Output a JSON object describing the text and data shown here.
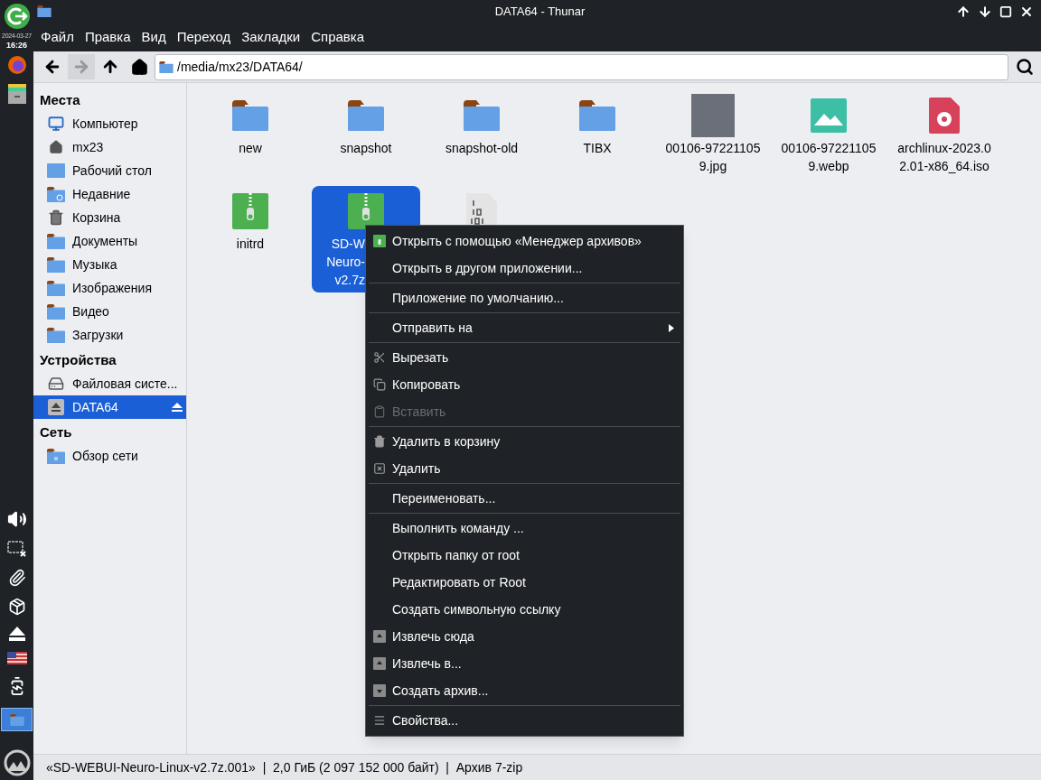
{
  "panel": {
    "date": "2024-03-27",
    "time": "16:26"
  },
  "window": {
    "title": "DATA64 - Thunar"
  },
  "menu_bar": [
    "Файл",
    "Правка",
    "Вид",
    "Переход",
    "Закладки",
    "Справка"
  ],
  "toolbar": {
    "back_disabled": false,
    "forward_disabled": true,
    "location": "/media/mx23/DATA64/"
  },
  "sidebar": [
    {
      "heading": "Места",
      "items": [
        {
          "label": "Компьютер",
          "kind": "computer",
          "selected": false
        },
        {
          "label": "mx23",
          "kind": "home",
          "selected": false
        },
        {
          "label": "Рабочий стол",
          "kind": "desktop",
          "selected": false
        },
        {
          "label": "Недавние",
          "kind": "recent",
          "selected": false
        },
        {
          "label": "Корзина",
          "kind": "trash",
          "selected": false
        },
        {
          "label": "Документы",
          "kind": "folder",
          "selected": false
        },
        {
          "label": "Музыка",
          "kind": "folder",
          "selected": false
        },
        {
          "label": "Изображения",
          "kind": "folder",
          "selected": false
        },
        {
          "label": "Видео",
          "kind": "folder",
          "selected": false
        },
        {
          "label": "Загрузки",
          "kind": "folder",
          "selected": false
        }
      ]
    },
    {
      "heading": "Устройства",
      "items": [
        {
          "label": "Файловая систе...",
          "kind": "drive",
          "selected": false
        },
        {
          "label": "DATA64",
          "kind": "removable",
          "selected": true
        }
      ]
    },
    {
      "heading": "Сеть",
      "items": [
        {
          "label": "Обзор сети",
          "kind": "network",
          "selected": false
        }
      ]
    }
  ],
  "files": [
    {
      "name": [
        "new"
      ],
      "kind": "folder",
      "selected": false
    },
    {
      "name": [
        "snapshot"
      ],
      "kind": "folder",
      "selected": false
    },
    {
      "name": [
        "snapshot-old"
      ],
      "kind": "folder",
      "selected": false
    },
    {
      "name": [
        "TIBX"
      ],
      "kind": "folder",
      "selected": false
    },
    {
      "name": [
        "00106-97221105",
        "9.jpg"
      ],
      "kind": "photo",
      "selected": false
    },
    {
      "name": [
        "00106-97221105",
        "9.webp"
      ],
      "kind": "image",
      "selected": false
    },
    {
      "name": [
        "archlinux-2023.0",
        "2.01-x86_64.iso"
      ],
      "kind": "disc",
      "selected": false
    },
    {
      "name": [
        "initrd"
      ],
      "kind": "archive",
      "selected": false
    },
    {
      "name": [
        "SD-W",
        "Neuro-",
        "v2.7z"
      ],
      "kind": "archive",
      "selected": true
    },
    {
      "kind": "binary",
      "selected": false
    }
  ],
  "context_menu": [
    {
      "kind": "archive",
      "label": "Открыть с помощью «Менеджер архивов»",
      "disabled": false
    },
    {
      "kind": "plain",
      "label": "Открыть в другом приложении...",
      "disabled": false
    },
    {
      "kind": "separator"
    },
    {
      "kind": "plain",
      "label": "Приложение по умолчанию...",
      "disabled": false
    },
    {
      "kind": "separator"
    },
    {
      "kind": "submenu",
      "label": "Отправить на",
      "disabled": false
    },
    {
      "kind": "separator"
    },
    {
      "kind": "cut",
      "label": "Вырезать",
      "disabled": false
    },
    {
      "kind": "copy",
      "label": "Копировать",
      "disabled": false
    },
    {
      "kind": "paste",
      "label": "Вставить",
      "disabled": true
    },
    {
      "kind": "separator"
    },
    {
      "kind": "trash",
      "label": "Удалить в корзину",
      "disabled": false
    },
    {
      "kind": "delete",
      "label": "Удалить",
      "disabled": false
    },
    {
      "kind": "separator"
    },
    {
      "kind": "plain",
      "label": "Переименовать...",
      "disabled": false
    },
    {
      "kind": "separator"
    },
    {
      "kind": "plain",
      "label": "Выполнить команду ...",
      "disabled": false
    },
    {
      "kind": "plain",
      "label": "Открыть папку от root",
      "disabled": false
    },
    {
      "kind": "plain",
      "label": "Редактировать от Root",
      "disabled": false
    },
    {
      "kind": "plain",
      "label": "Создать символьную ссылку",
      "disabled": false
    },
    {
      "kind": "extract",
      "label": "Извлечь сюда",
      "disabled": false
    },
    {
      "kind": "extract",
      "label": "Извлечь в...",
      "disabled": false
    },
    {
      "kind": "compress",
      "label": "Создать архив...",
      "disabled": false
    },
    {
      "kind": "separator"
    },
    {
      "kind": "properties",
      "label": "Свойства...",
      "disabled": false
    }
  ],
  "status_bar": "«SD-WEBUI-Neuro-Linux-v2.7z.001»  |  2,0 ГиБ (2 097 152 000 байт)  |  Архив 7-zip"
}
